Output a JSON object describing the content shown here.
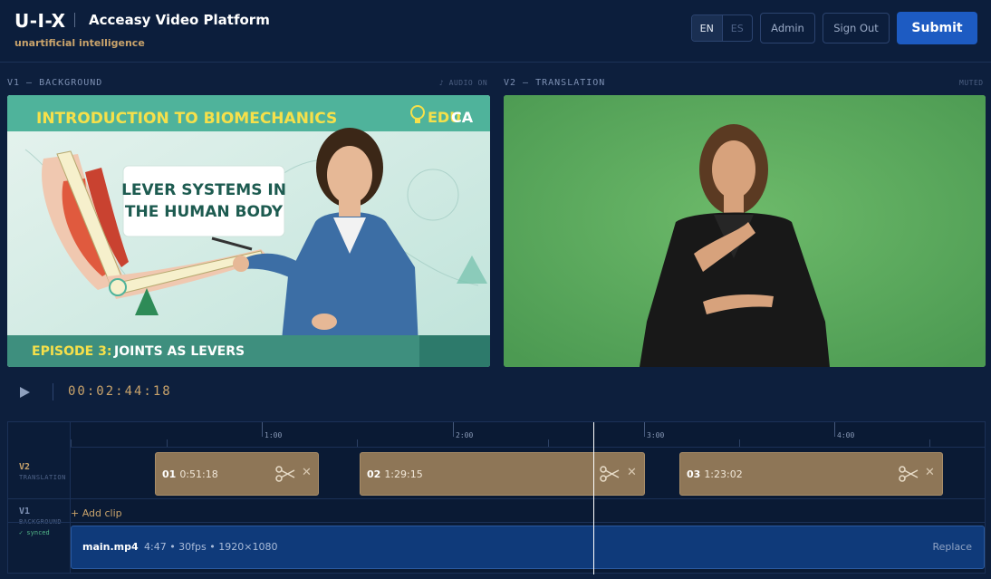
{
  "header": {
    "logo": "U-I-X",
    "title": "Acceasy Video Platform",
    "tagline": "unartificial intelligence",
    "lang_en": "EN",
    "lang_es": "ES",
    "admin": "Admin",
    "sign_out": "Sign Out",
    "submit": "Submit"
  },
  "panels": {
    "v1_label": "V1 — BACKGROUND",
    "v1_status": "♪ AUDIO ON",
    "v2_label": "V2 — TRANSLATION",
    "v2_status": "MUTED"
  },
  "v1_video": {
    "course_title": "INTRODUCTION TO BIOMECHANICS",
    "brand_a": "EDU",
    "brand_b": "CA",
    "topic_line1": "LEVER SYSTEMS IN",
    "topic_line2": "THE HUMAN BODY",
    "episode_a": "EPISODE 3:",
    "episode_b": " JOINTS AS LEVERS"
  },
  "playback": {
    "timecode": "00:02:44:18"
  },
  "timeline": {
    "ruler_labels": [
      "1:00",
      "2:00",
      "3:00",
      "4:00"
    ],
    "v2": {
      "name": "V2",
      "sub": "TRANSLATION"
    },
    "v1": {
      "name": "V1",
      "sub": "BACKGROUND",
      "synced": "✓ synced"
    },
    "clips": [
      {
        "index": "01",
        "duration": "0:51:18"
      },
      {
        "index": "02",
        "duration": "1:29:15"
      },
      {
        "index": "03",
        "duration": "1:23:02"
      }
    ],
    "add_clip": "+ Add clip",
    "main_file": {
      "name": "main.mp4",
      "meta": "4:47 • 30fps • 1920×1080",
      "replace": "Replace"
    }
  },
  "colors": {
    "accent": "#1d5bc2",
    "gold": "#c9a36b",
    "clip": "#8e7657",
    "v1_strip": "#0f3a7a",
    "green_screen": "#58a85c"
  }
}
